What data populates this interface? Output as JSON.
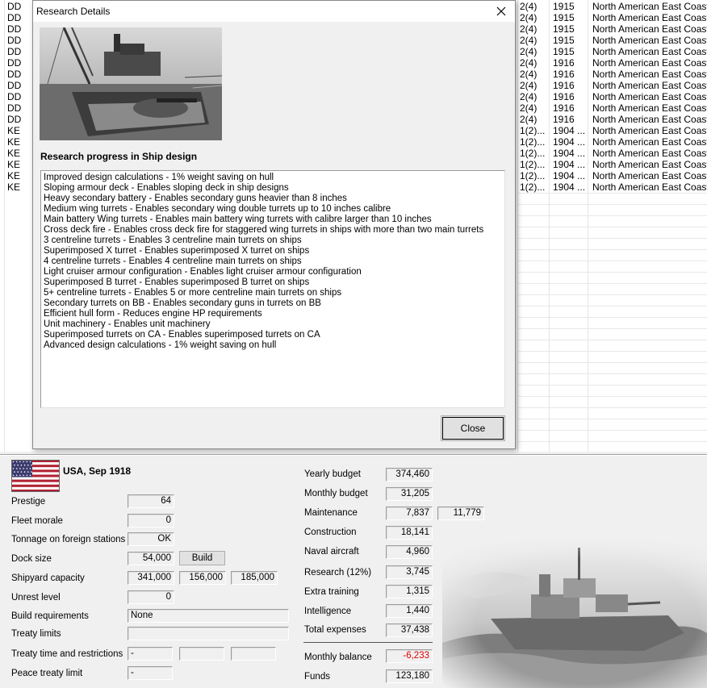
{
  "fleet_list": {
    "rows": [
      {
        "type": "DD",
        "num": "2(4)",
        "year": "1915",
        "area": "North American East Coast"
      },
      {
        "type": "DD",
        "num": "2(4)",
        "year": "1915",
        "area": "North American East Coast"
      },
      {
        "type": "DD",
        "num": "2(4)",
        "year": "1915",
        "area": "North American East Coast"
      },
      {
        "type": "DD",
        "num": "2(4)",
        "year": "1915",
        "area": "North American East Coast"
      },
      {
        "type": "DD",
        "num": "2(4)",
        "year": "1915",
        "area": "North American East Coast"
      },
      {
        "type": "DD",
        "num": "2(4)",
        "year": "1916",
        "area": "North American East Coast"
      },
      {
        "type": "DD",
        "num": "2(4)",
        "year": "1916",
        "area": "North American East Coast"
      },
      {
        "type": "DD",
        "num": "2(4)",
        "year": "1916",
        "area": "North American East Coast"
      },
      {
        "type": "DD",
        "num": "2(4)",
        "year": "1916",
        "area": "North American East Coast"
      },
      {
        "type": "DD",
        "num": "2(4)",
        "year": "1916",
        "area": "North American East Coast"
      },
      {
        "type": "DD",
        "num": "2(4)",
        "year": "1916",
        "area": "North American East Coast"
      },
      {
        "type": "KE",
        "num": "1(2)...",
        "year": "1904 ...",
        "area": "North American East Coast"
      },
      {
        "type": "KE",
        "num": "1(2)...",
        "year": "1904 ...",
        "area": "North American East Coast"
      },
      {
        "type": "KE",
        "num": "1(2)...",
        "year": "1904 ...",
        "area": "North American East Coast"
      },
      {
        "type": "KE",
        "num": "1(2)...",
        "year": "1904 ...",
        "area": "North American East Coast"
      },
      {
        "type": "KE",
        "num": "1(2)...",
        "year": "1904 ...",
        "area": "North American East Coast"
      },
      {
        "type": "KE",
        "num": "1(2)...",
        "year": "1904 ...",
        "area": "North American East Coast"
      }
    ]
  },
  "dialog": {
    "title": "Research Details",
    "close_x": "✕",
    "heading": "Research progress in Ship design",
    "items": [
      "Improved design calculations - 1% weight saving on hull",
      "Sloping armour deck - Enables sloping deck in ship designs",
      "Heavy secondary battery - Enables secondary guns heavier than 8 inches",
      "Medium wing turrets - Enables secondary wing double turrets up to 10 inches calibre",
      "Main battery Wing turrets - Enables main battery wing turrets with calibre larger than 10 inches",
      "Cross deck fire - Enables cross deck fire for staggered wing turrets in ships with more than two main turrets",
      "3 centreline turrets - Enables 3 centreline main turrets on ships",
      "Superimposed X turret - Enables superimposed X turret on ships",
      "4 centreline turrets - Enables 4 centreline main turrets on ships",
      "Light cruiser armour configuration - Enables light cruiser armour configuration",
      "Superimposed B turret - Enables superimposed B turret on ships",
      "5+ centreline turrets - Enables 5 or more centreline main turrets on ships",
      "Secondary turrets on BB -  Enables secondary guns in turrets on BB",
      "Efficient hull form - Reduces engine HP requirements",
      "Unit machinery - Enables unit machinery",
      "Superimposed turrets on CA - Enables superimposed turrets on CA",
      "Advanced design calculations - 1% weight saving on hull"
    ],
    "close_label": "Close"
  },
  "nation": {
    "title": "USA, Sep 1918",
    "flag_colors": {
      "red": "#b22234",
      "white": "#ffffff",
      "blue": "#3c3b6e"
    }
  },
  "stats": {
    "prestige": {
      "label": "Prestige",
      "value": "64"
    },
    "fleet_morale": {
      "label": "Fleet morale",
      "value": "0"
    },
    "tonnage_foreign": {
      "label": "Tonnage on foreign stations",
      "value": "OK"
    },
    "dock_size": {
      "label": "Dock size",
      "value": "54,000",
      "button": "Build"
    },
    "shipyard_capacity": {
      "label": "Shipyard capacity",
      "values": [
        "341,000",
        "156,000",
        "185,000"
      ]
    },
    "unrest_level": {
      "label": "Unrest level",
      "value": "0"
    },
    "build_requirements": {
      "label": "Build requirements",
      "value": "None"
    },
    "treaty_limits": {
      "label": "Treaty limits",
      "value": ""
    },
    "treaty_time": {
      "label": "Treaty time and restrictions",
      "values": [
        "-",
        "",
        ""
      ]
    },
    "peace_treaty": {
      "label": "Peace treaty limit",
      "value": "-"
    }
  },
  "budget": {
    "yearly": {
      "label": "Yearly budget",
      "value": "374,460"
    },
    "monthly": {
      "label": "Monthly budget",
      "value": "31,205"
    },
    "maintenance": {
      "label": "Maintenance",
      "value": "7,837",
      "value2": "11,779"
    },
    "construction": {
      "label": "Construction",
      "value": "18,141"
    },
    "naval_aircraft": {
      "label": "Naval aircraft",
      "value": "4,960"
    },
    "research": {
      "label": "Research (12%)",
      "value": "3,745"
    },
    "extra_training": {
      "label": "Extra training",
      "value": "1,315"
    },
    "intelligence": {
      "label": "Intelligence",
      "value": "1,440"
    },
    "total": {
      "label": "Total expenses",
      "value": "37,438"
    },
    "balance": {
      "label": "Monthly balance",
      "value": "-6,233",
      "color": "#e00000"
    },
    "funds": {
      "label": "Funds",
      "value": "123,180"
    }
  }
}
